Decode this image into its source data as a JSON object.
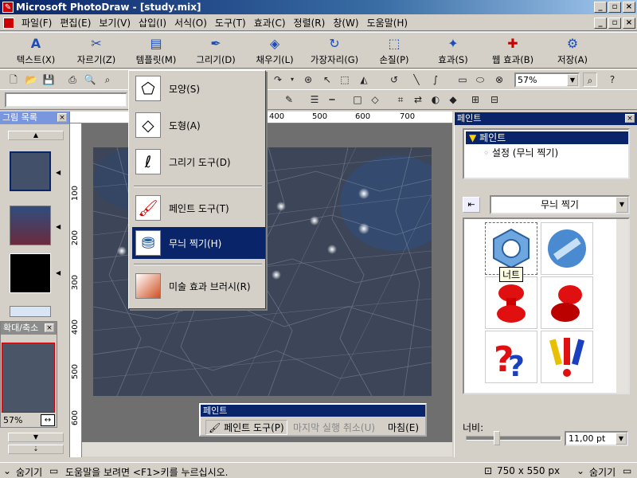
{
  "window": {
    "title": "Microsoft PhotoDraw - [study.mix]"
  },
  "menu": [
    "파일(F)",
    "편집(E)",
    "보기(V)",
    "삽입(I)",
    "서식(O)",
    "도구(T)",
    "효과(C)",
    "정렬(R)",
    "창(W)",
    "도움말(H)"
  ],
  "big_toolbar": [
    {
      "label": "텍스트(X)",
      "icon": "text-icon"
    },
    {
      "label": "자르기(Z)",
      "icon": "crop-icon"
    },
    {
      "label": "템플릿(M)",
      "icon": "template-icon"
    },
    {
      "label": "그리기(D)",
      "icon": "draw-icon"
    },
    {
      "label": "채우기(L)",
      "icon": "fill-icon"
    },
    {
      "label": "가장자리(G)",
      "icon": "edge-icon"
    },
    {
      "label": "손질(P)",
      "icon": "touchup-icon"
    },
    {
      "label": "효과(S)",
      "icon": "effects-icon"
    },
    {
      "label": "웹 효과(B)",
      "icon": "web-effects-icon"
    },
    {
      "label": "저장(A)",
      "icon": "save-icon"
    }
  ],
  "toolbar": {
    "zoom_value": "57%"
  },
  "dropdown_menu": [
    {
      "label": "모양(S)",
      "icon": "shape-icon"
    },
    {
      "label": "도형(A)",
      "icon": "autoshape-icon"
    },
    {
      "label": "그리기 도구(D)",
      "icon": "draw-tool-icon"
    },
    {
      "label": "페인트 도구(T)",
      "icon": "paint-tool-icon"
    },
    {
      "label": "무늬 찍기(H)",
      "icon": "stamp-icon"
    },
    {
      "label": "미술 효과 브러시(R)",
      "icon": "artistic-brush-icon"
    }
  ],
  "dropdown_active": "무늬 찍기(H)",
  "left_panel": {
    "title": "그림 목록",
    "thumbnail_count": 4
  },
  "zoom_panel": {
    "title": "확대/축소",
    "value": "57%"
  },
  "rulers": {
    "top": [
      "400",
      "500",
      "600",
      "700"
    ],
    "left": [
      "100",
      "200",
      "300",
      "400",
      "500",
      "600"
    ]
  },
  "paint_panel": {
    "title": "페인트",
    "tree_root": "페인트",
    "tree_child": "설정 (무늬 찍기)",
    "pattern_category": "무늬 찍기",
    "tooltip": "너트",
    "width_label": "너비:",
    "width_value": "11,00 pt",
    "width_level": 0.31
  },
  "float_toolbar": {
    "title": "페인트",
    "paint_tool": "페인트 도구(P)",
    "undo": "마지막 실행 취소(U)",
    "done": "마침(E)"
  },
  "status": {
    "hide_left": "숨기기",
    "help_text": "도움말을 보려면 <F1>키를 누르십시오.",
    "dimensions": "750 x 550  px",
    "hide_right": "숨기기"
  }
}
